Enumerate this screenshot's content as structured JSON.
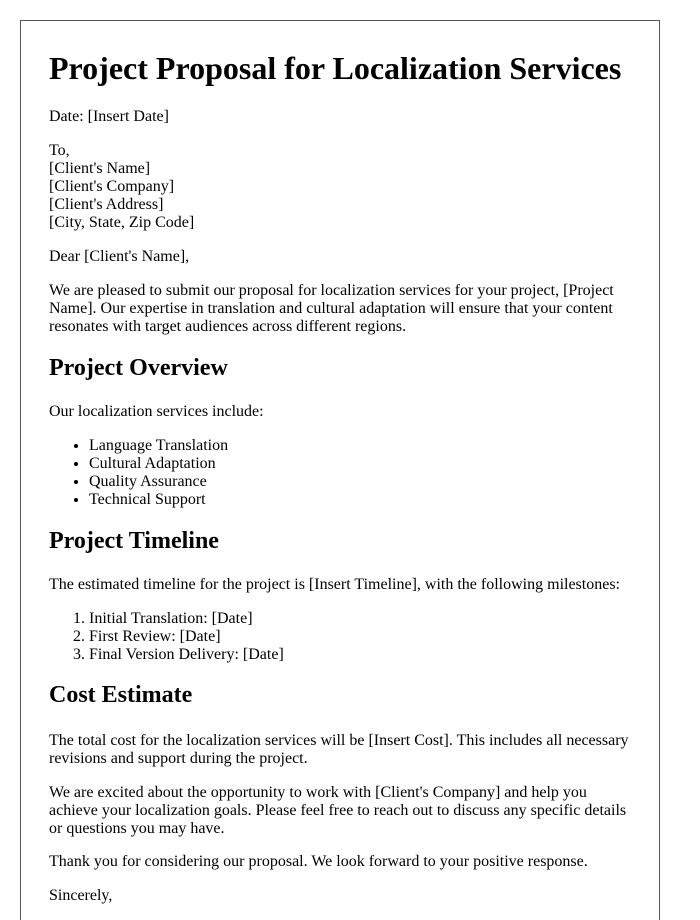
{
  "document": {
    "title": "Project Proposal for Localization Services",
    "date_line": "Date: [Insert Date]",
    "address": [
      "To,",
      "[Client's Name]",
      "[Client's Company]",
      "[Client's Address]",
      "[City, State, Zip Code]"
    ],
    "salutation": "Dear [Client's Name],",
    "intro": "We are pleased to submit our proposal for localization services for your project, [Project Name]. Our expertise in translation and cultural adaptation will ensure that your content resonates with target audiences across different regions.",
    "overview": {
      "heading": "Project Overview",
      "lead": "Our localization services include:",
      "items": [
        "Language Translation",
        "Cultural Adaptation",
        "Quality Assurance",
        "Technical Support"
      ]
    },
    "timeline": {
      "heading": "Project Timeline",
      "lead": "The estimated timeline for the project is [Insert Timeline], with the following milestones:",
      "milestones": [
        "Initial Translation: [Date]",
        "First Review: [Date]",
        "Final Version Delivery: [Date]"
      ]
    },
    "cost": {
      "heading": "Cost Estimate",
      "text": "The total cost for the localization services will be [Insert Cost]. This includes all necessary revisions and support during the project."
    },
    "closing_paragraph": "We are excited about the opportunity to work with [Client's Company] and help you achieve your localization goals. Please feel free to reach out to discuss any specific details or questions you may have.",
    "thanks": "Thank you for considering our proposal. We look forward to your positive response.",
    "signoff": "Sincerely,"
  }
}
